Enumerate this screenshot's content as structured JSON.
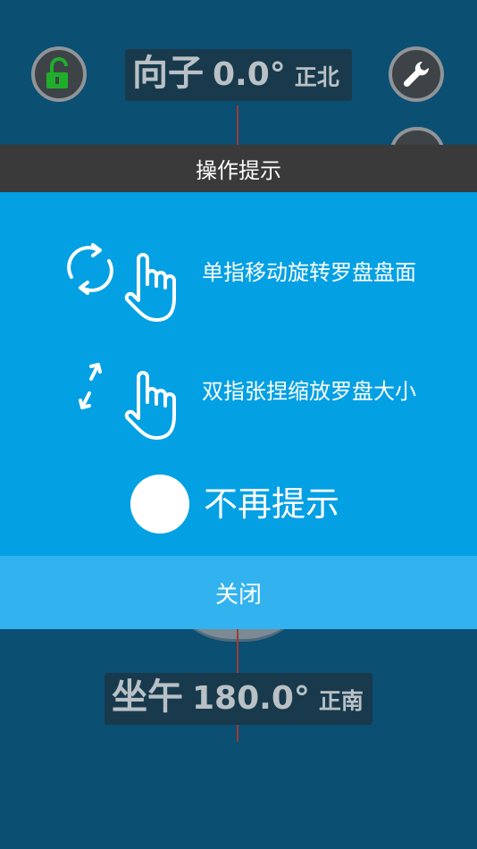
{
  "compass": {
    "top": {
      "label": "向子",
      "angle": "0.0°",
      "direction": "正北"
    },
    "bottom": {
      "label": "坐午",
      "angle": "180.0°",
      "direction": "正南"
    }
  },
  "buttons": {
    "lock_icon": "unlock-icon",
    "settings_icon": "wrench-icon"
  },
  "modal": {
    "title": "操作提示",
    "tips": [
      {
        "icon": "rotate-icon",
        "text": "单指移动旋转罗盘盘面"
      },
      {
        "icon": "pinch-zoom-icon",
        "text": "双指张捏缩放罗盘大小"
      }
    ],
    "no_remind_label": "不再提示",
    "close_label": "关闭"
  },
  "colors": {
    "background": "#0b4f72",
    "modal_body": "#03a0e4",
    "modal_header": "#3a3a3a",
    "close_bar": "#32b3ef",
    "lock_green": "#1fae2a"
  }
}
